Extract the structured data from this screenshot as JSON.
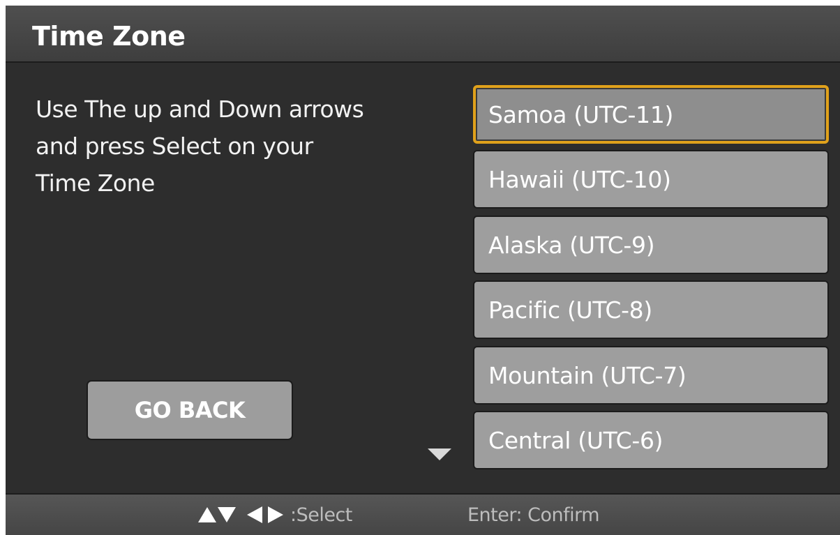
{
  "header": {
    "title": "Time Zone"
  },
  "main": {
    "instructions": {
      "line1": "Use The up and Down arrows",
      "line2": "and press Select on your",
      "line3": "Time Zone"
    },
    "go_back_label": "GO BACK",
    "time_zones": [
      {
        "label": "Samoa (UTC-11)",
        "selected": true
      },
      {
        "label": "Hawaii (UTC-10)",
        "selected": false
      },
      {
        "label": "Alaska (UTC-9)",
        "selected": false
      },
      {
        "label": "Pacific (UTC-8)",
        "selected": false
      },
      {
        "label": "Mountain (UTC-7)",
        "selected": false
      },
      {
        "label": "Central (UTC-6)",
        "selected": false
      }
    ],
    "scroll_icon": "triangle-down-icon"
  },
  "footer": {
    "select_hint": ":Select",
    "confirm_hint": "Enter: Confirm",
    "nav_icons": [
      "arrow-up-icon",
      "arrow-down-icon",
      "arrow-left-icon",
      "arrow-right-icon"
    ]
  },
  "colors": {
    "highlight_border": "#e0a11b",
    "button_fill": "#9e9e9e",
    "panel_background": "#2d2d2d"
  }
}
